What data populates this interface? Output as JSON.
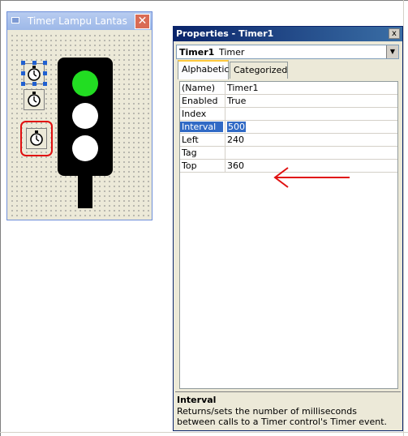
{
  "form_window": {
    "title": "Timer Lampu Lantas",
    "close_glyph": "✕",
    "timers": [
      "Timer1",
      "Timer2",
      "Timer3"
    ],
    "traffic_light": {
      "top_lamp_color": "#22dd22",
      "middle_lamp_color": "#ffffff",
      "bottom_lamp_color": "#ffffff",
      "body_color": "#000000"
    }
  },
  "properties_window": {
    "title": "Properties - Timer1",
    "close_glyph": "x",
    "object_name": "Timer1",
    "object_type": "Timer",
    "tabs": [
      {
        "label": "Alphabetic",
        "active": true
      },
      {
        "label": "Categorized",
        "active": false
      }
    ],
    "rows": [
      {
        "name": "(Name)",
        "value": "Timer1"
      },
      {
        "name": "Enabled",
        "value": "True"
      },
      {
        "name": "Index",
        "value": ""
      },
      {
        "name": "Interval",
        "value": "500",
        "selected": true
      },
      {
        "name": "Left",
        "value": "240"
      },
      {
        "name": "Tag",
        "value": ""
      },
      {
        "name": "Top",
        "value": "360"
      }
    ],
    "description": {
      "title": "Interval",
      "text": "Returns/sets the number of milliseconds between calls to a Timer control's Timer event."
    }
  },
  "colors": {
    "annotation_red": "#e01010",
    "selection_blue": "#316ac5"
  }
}
